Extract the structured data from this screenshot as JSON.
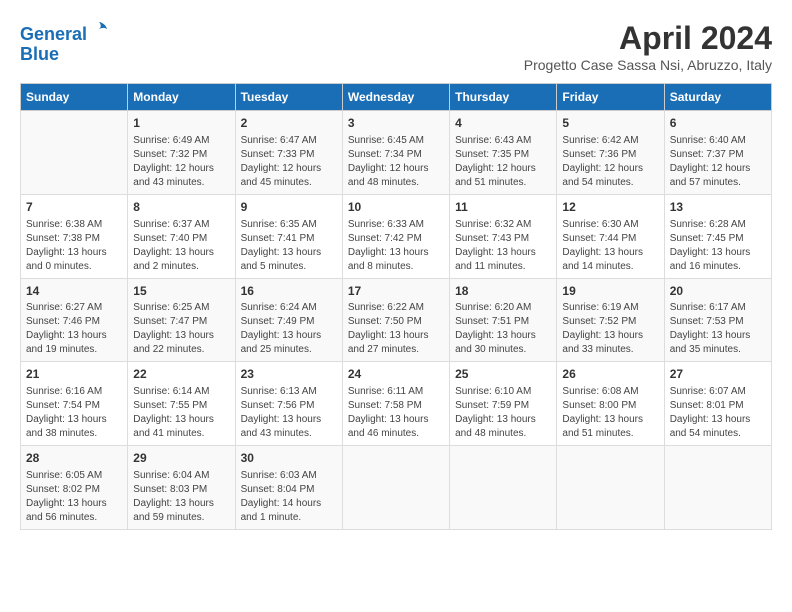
{
  "header": {
    "logo_line1": "General",
    "logo_line2": "Blue",
    "month_title": "April 2024",
    "subtitle": "Progetto Case Sassa Nsi, Abruzzo, Italy"
  },
  "days_of_week": [
    "Sunday",
    "Monday",
    "Tuesday",
    "Wednesday",
    "Thursday",
    "Friday",
    "Saturday"
  ],
  "weeks": [
    [
      {
        "day": "",
        "info": ""
      },
      {
        "day": "1",
        "info": "Sunrise: 6:49 AM\nSunset: 7:32 PM\nDaylight: 12 hours\nand 43 minutes."
      },
      {
        "day": "2",
        "info": "Sunrise: 6:47 AM\nSunset: 7:33 PM\nDaylight: 12 hours\nand 45 minutes."
      },
      {
        "day": "3",
        "info": "Sunrise: 6:45 AM\nSunset: 7:34 PM\nDaylight: 12 hours\nand 48 minutes."
      },
      {
        "day": "4",
        "info": "Sunrise: 6:43 AM\nSunset: 7:35 PM\nDaylight: 12 hours\nand 51 minutes."
      },
      {
        "day": "5",
        "info": "Sunrise: 6:42 AM\nSunset: 7:36 PM\nDaylight: 12 hours\nand 54 minutes."
      },
      {
        "day": "6",
        "info": "Sunrise: 6:40 AM\nSunset: 7:37 PM\nDaylight: 12 hours\nand 57 minutes."
      }
    ],
    [
      {
        "day": "7",
        "info": "Sunrise: 6:38 AM\nSunset: 7:38 PM\nDaylight: 13 hours\nand 0 minutes."
      },
      {
        "day": "8",
        "info": "Sunrise: 6:37 AM\nSunset: 7:40 PM\nDaylight: 13 hours\nand 2 minutes."
      },
      {
        "day": "9",
        "info": "Sunrise: 6:35 AM\nSunset: 7:41 PM\nDaylight: 13 hours\nand 5 minutes."
      },
      {
        "day": "10",
        "info": "Sunrise: 6:33 AM\nSunset: 7:42 PM\nDaylight: 13 hours\nand 8 minutes."
      },
      {
        "day": "11",
        "info": "Sunrise: 6:32 AM\nSunset: 7:43 PM\nDaylight: 13 hours\nand 11 minutes."
      },
      {
        "day": "12",
        "info": "Sunrise: 6:30 AM\nSunset: 7:44 PM\nDaylight: 13 hours\nand 14 minutes."
      },
      {
        "day": "13",
        "info": "Sunrise: 6:28 AM\nSunset: 7:45 PM\nDaylight: 13 hours\nand 16 minutes."
      }
    ],
    [
      {
        "day": "14",
        "info": "Sunrise: 6:27 AM\nSunset: 7:46 PM\nDaylight: 13 hours\nand 19 minutes."
      },
      {
        "day": "15",
        "info": "Sunrise: 6:25 AM\nSunset: 7:47 PM\nDaylight: 13 hours\nand 22 minutes."
      },
      {
        "day": "16",
        "info": "Sunrise: 6:24 AM\nSunset: 7:49 PM\nDaylight: 13 hours\nand 25 minutes."
      },
      {
        "day": "17",
        "info": "Sunrise: 6:22 AM\nSunset: 7:50 PM\nDaylight: 13 hours\nand 27 minutes."
      },
      {
        "day": "18",
        "info": "Sunrise: 6:20 AM\nSunset: 7:51 PM\nDaylight: 13 hours\nand 30 minutes."
      },
      {
        "day": "19",
        "info": "Sunrise: 6:19 AM\nSunset: 7:52 PM\nDaylight: 13 hours\nand 33 minutes."
      },
      {
        "day": "20",
        "info": "Sunrise: 6:17 AM\nSunset: 7:53 PM\nDaylight: 13 hours\nand 35 minutes."
      }
    ],
    [
      {
        "day": "21",
        "info": "Sunrise: 6:16 AM\nSunset: 7:54 PM\nDaylight: 13 hours\nand 38 minutes."
      },
      {
        "day": "22",
        "info": "Sunrise: 6:14 AM\nSunset: 7:55 PM\nDaylight: 13 hours\nand 41 minutes."
      },
      {
        "day": "23",
        "info": "Sunrise: 6:13 AM\nSunset: 7:56 PM\nDaylight: 13 hours\nand 43 minutes."
      },
      {
        "day": "24",
        "info": "Sunrise: 6:11 AM\nSunset: 7:58 PM\nDaylight: 13 hours\nand 46 minutes."
      },
      {
        "day": "25",
        "info": "Sunrise: 6:10 AM\nSunset: 7:59 PM\nDaylight: 13 hours\nand 48 minutes."
      },
      {
        "day": "26",
        "info": "Sunrise: 6:08 AM\nSunset: 8:00 PM\nDaylight: 13 hours\nand 51 minutes."
      },
      {
        "day": "27",
        "info": "Sunrise: 6:07 AM\nSunset: 8:01 PM\nDaylight: 13 hours\nand 54 minutes."
      }
    ],
    [
      {
        "day": "28",
        "info": "Sunrise: 6:05 AM\nSunset: 8:02 PM\nDaylight: 13 hours\nand 56 minutes."
      },
      {
        "day": "29",
        "info": "Sunrise: 6:04 AM\nSunset: 8:03 PM\nDaylight: 13 hours\nand 59 minutes."
      },
      {
        "day": "30",
        "info": "Sunrise: 6:03 AM\nSunset: 8:04 PM\nDaylight: 14 hours\nand 1 minute."
      },
      {
        "day": "",
        "info": ""
      },
      {
        "day": "",
        "info": ""
      },
      {
        "day": "",
        "info": ""
      },
      {
        "day": "",
        "info": ""
      }
    ]
  ]
}
